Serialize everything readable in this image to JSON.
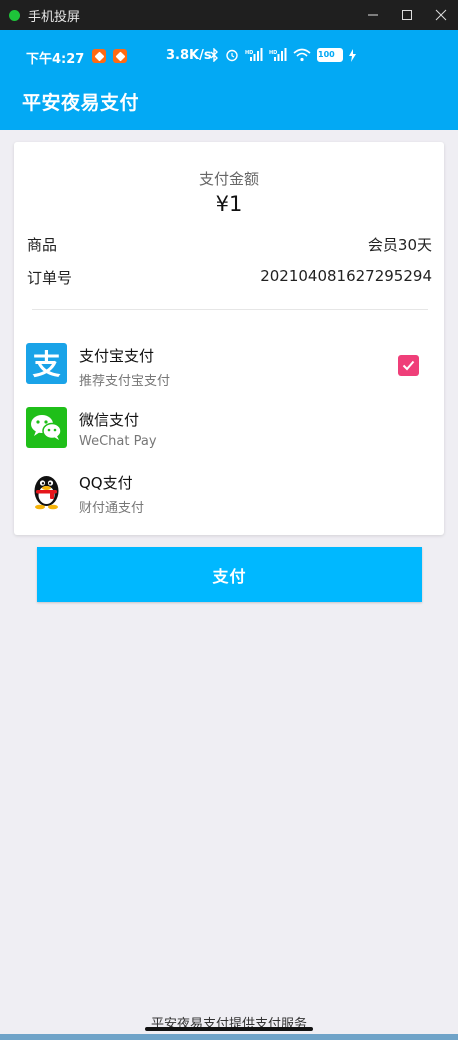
{
  "window": {
    "title": "手机投屏",
    "controls": [
      "minimize-icon",
      "maximize-icon",
      "close-icon"
    ]
  },
  "status_bar": {
    "time": "下午4:27",
    "network_speed": "3.8K/s",
    "battery": "100",
    "icons": [
      "bluetooth-icon",
      "alarm-icon",
      "signal-hd-icon",
      "signal-hd-icon",
      "wifi-icon",
      "battery-icon",
      "charging-icon"
    ]
  },
  "app_bar": {
    "title": "平安夜易支付"
  },
  "payment": {
    "amount_label": "支付金额",
    "amount": "¥1",
    "product_label": "商品",
    "product_value": "会员30天",
    "order_label": "订单号",
    "order_value": "202104081627295294"
  },
  "methods": [
    {
      "name": "支付宝支付",
      "desc": "推荐支付宝支付",
      "icon": "alipay-icon",
      "selected": true
    },
    {
      "name": "微信支付",
      "desc": "WeChat Pay",
      "icon": "wechat-icon",
      "selected": false
    },
    {
      "name": "QQ支付",
      "desc": "财付通支付",
      "icon": "qq-penguin-icon",
      "selected": false
    }
  ],
  "pay_button": "支付",
  "footer": "平安夜易支付提供支付服务",
  "colors": {
    "primary": "#03a9f4",
    "button": "#00b8ff",
    "checkbox": "#ef3f79",
    "background": "#efeef3"
  }
}
